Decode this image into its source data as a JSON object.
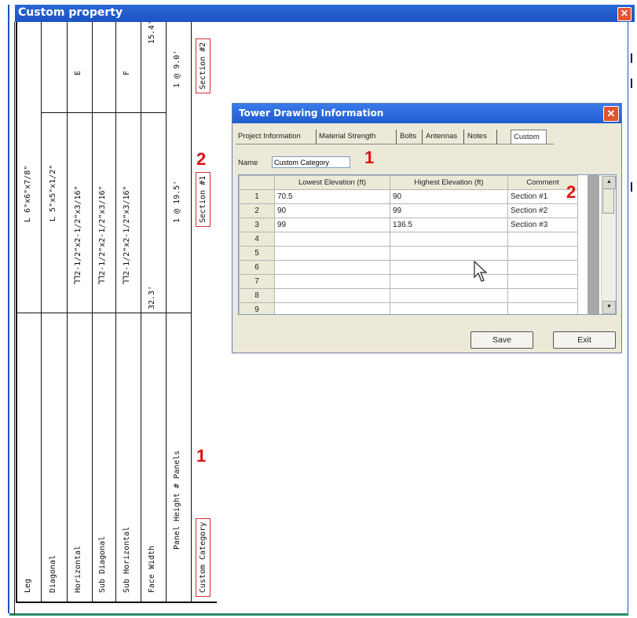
{
  "window": {
    "title": "Custom property",
    "close_glyph": "✕"
  },
  "drawing": {
    "row_labels": [
      "Leg",
      "Diagonal",
      "Horizontal",
      "Sub Diagonal",
      "Sub Horizontal",
      "Face Width",
      "Panel Height # Panels",
      "Custom Category"
    ],
    "section1": {
      "leg": "L 6\"x6\"x7/8\"",
      "diagonal": "L 5\"x5\"x1/2\"",
      "horizontal": "⅂⅂2-1/2\"x2-1/2\"x3/16\"",
      "sub_diagonal": "⅂⅂2-1/2\"x2-1/2\"x3/16\"",
      "sub_horizontal": "⅂⅂2-1/2\"x2-1/2\"x3/16\"",
      "face_width": "32.3'",
      "panel": "1 @ 19.5'",
      "custom": "Section #1"
    },
    "section2": {
      "horizontal": "E",
      "sub_horizontal": "F",
      "face_width": "15.4'",
      "panel": "1 @ 9.0'",
      "custom": "Section #2"
    },
    "annotations": {
      "one": "1",
      "two": "2"
    }
  },
  "dialog": {
    "title": "Tower Drawing Information",
    "close_glyph": "✕",
    "tabs": [
      "Project Information",
      "Material Strength",
      "Bolts",
      "Antennas",
      "Notes",
      "Custom"
    ],
    "active_tab": "Custom",
    "name_label": "Name",
    "name_value": "Custom Category",
    "columns": [
      "Lowest Elevation (ft)",
      "Highest Elevation (ft)",
      "Comment"
    ],
    "rows": [
      {
        "n": "1",
        "low": "70.5",
        "high": "90",
        "comment": "Section #1"
      },
      {
        "n": "2",
        "low": "90",
        "high": "99",
        "comment": "Section #2"
      },
      {
        "n": "3",
        "low": "99",
        "high": "136.5",
        "comment": "Section #3"
      },
      {
        "n": "4",
        "low": "",
        "high": "",
        "comment": ""
      },
      {
        "n": "5",
        "low": "",
        "high": "",
        "comment": ""
      },
      {
        "n": "6",
        "low": "",
        "high": "",
        "comment": ""
      },
      {
        "n": "7",
        "low": "",
        "high": "",
        "comment": ""
      },
      {
        "n": "8",
        "low": "",
        "high": "",
        "comment": ""
      },
      {
        "n": "9",
        "low": "",
        "high": "",
        "comment": ""
      }
    ],
    "scroll_up": "▲",
    "scroll_down": "▼",
    "save_label": "Save",
    "exit_label": "Exit",
    "annotations": {
      "one": "1",
      "two": "2"
    }
  },
  "colors": {
    "annotation_red": "#e01010",
    "title_blue": "#1f5bd0"
  }
}
